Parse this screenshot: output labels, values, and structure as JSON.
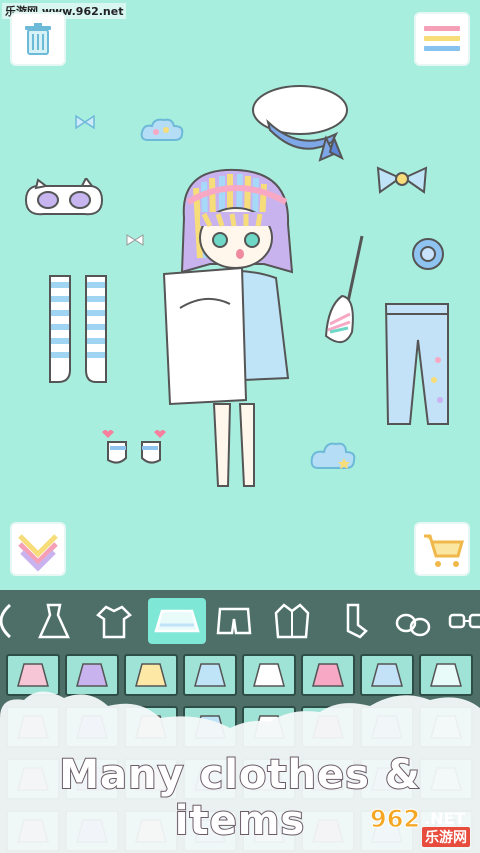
{
  "watermark_top": "乐游网 www.962.net",
  "top_left": {
    "icon": "trash-icon"
  },
  "top_right": {
    "icon": "menu-icon"
  },
  "bottom_left": {
    "icon": "chevron-down-icon"
  },
  "bottom_right": {
    "icon": "shopping-cart-icon"
  },
  "categories": [
    {
      "name": "dress-icon"
    },
    {
      "name": "tshirt-icon"
    },
    {
      "name": "skirt-icon",
      "active": true
    },
    {
      "name": "shorts-icon"
    },
    {
      "name": "jacket-icon"
    },
    {
      "name": "socks-icon"
    },
    {
      "name": "shoes-icon"
    },
    {
      "name": "glasses-icon"
    }
  ],
  "promo_text": "Many clothes & items",
  "watermark_bottom": {
    "logo": "962",
    "suffix": ".NET",
    "cn": "乐游网"
  }
}
